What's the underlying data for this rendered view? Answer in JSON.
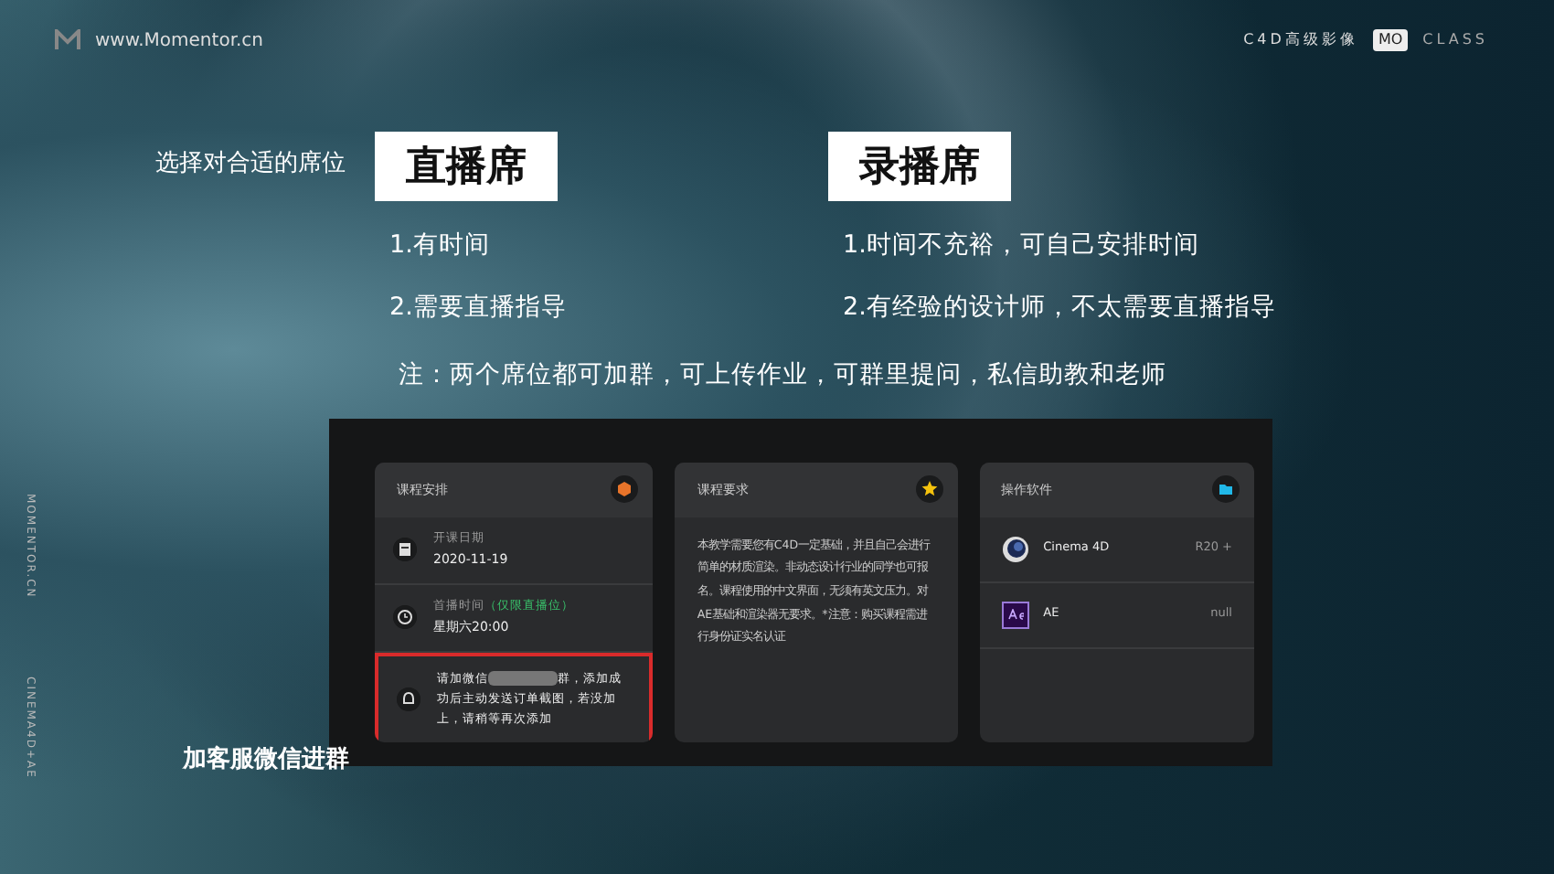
{
  "header": {
    "site": "www.Momentor.cn",
    "brand": "C4D高级影像",
    "brand_badge": "MO",
    "brand_suffix": "CLASS"
  },
  "side_labels": [
    "MOMENTOR.CN",
    "CINEMA4D+AE"
  ],
  "prompt": "选择对合适的席位",
  "seats": [
    {
      "title": "直播席",
      "points": [
        "1.有时间",
        "2.需要直播指导"
      ]
    },
    {
      "title": "录播席",
      "points": [
        "1.时间不充裕，可自己安排时间",
        "2.有经验的设计师，不太需要直播指导"
      ]
    }
  ],
  "note": "注：两个席位都可加群，可上传作业，可群里提问，私信助教和老师",
  "screenshot": {
    "cards": [
      {
        "kind": "schedule",
        "title": "课程安排",
        "items": [
          {
            "kind": "date",
            "label": "开课日期",
            "value": "2020-11-19",
            "highlighted": false
          },
          {
            "kind": "time",
            "label": "首播时间",
            "tag": "（仅限直播位）",
            "value": "星期六20:00",
            "highlighted": false
          },
          {
            "kind": "notice",
            "text_before": "请加微信",
            "text_after": "群，添加成功后主动发送订单截图，若没加上，请稍等再次添加",
            "highlighted": true
          }
        ]
      },
      {
        "kind": "text",
        "title": "课程要求",
        "body": "本教学需要您有C4D一定基础，并且自己会进行简单的材质渲染。非动态设计行业的同学也可报名。课程使用的中文界面，无须有英文压力。对AE基础和渲染器无要求。*注意：购买课程需进行身份证实名认证"
      },
      {
        "kind": "software",
        "title": "操作软件",
        "items": [
          {
            "kind": "c4d",
            "name": "Cinema 4D",
            "version": "R20 +"
          },
          {
            "kind": "ae",
            "name": "AE",
            "version": "null"
          }
        ]
      }
    ]
  },
  "caption": "加客服微信进群"
}
